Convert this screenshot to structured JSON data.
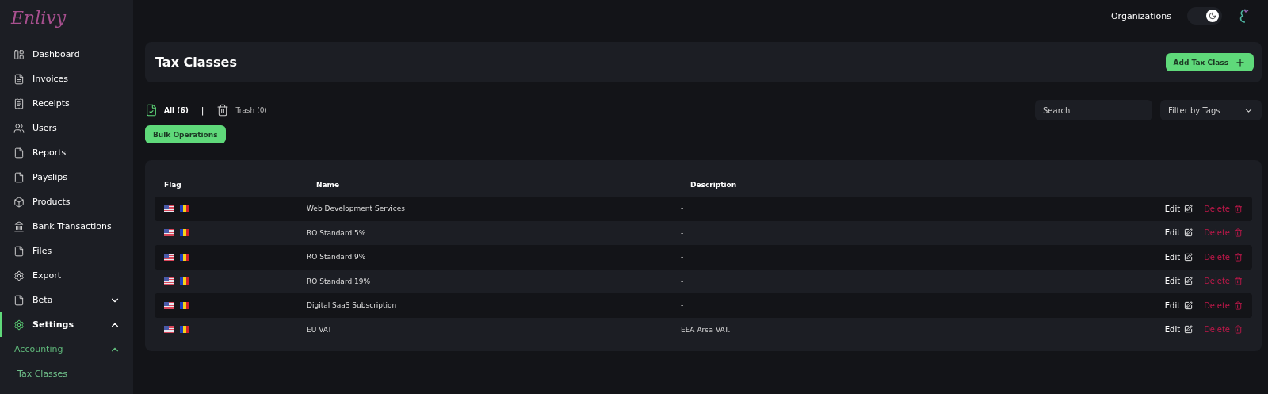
{
  "logo": "Enlivy",
  "sidebar": {
    "items": [
      {
        "label": "Dashboard",
        "selected": false
      },
      {
        "label": "Invoices",
        "selected": false
      },
      {
        "label": "Receipts",
        "selected": false
      },
      {
        "label": "Users",
        "selected": false
      },
      {
        "label": "Reports",
        "selected": false
      },
      {
        "label": "Payslips",
        "selected": false
      },
      {
        "label": "Products",
        "selected": false
      },
      {
        "label": "Bank Transactions",
        "selected": false
      },
      {
        "label": "Files",
        "selected": false
      },
      {
        "label": "Export",
        "selected": false
      },
      {
        "label": "Beta",
        "selected": false,
        "expanded": false
      },
      {
        "label": "Settings",
        "selected": true,
        "expanded": true,
        "children": [
          {
            "label": "Accounting",
            "expanded": true,
            "children": [
              {
                "label": "Tax Classes",
                "selected": true
              }
            ]
          }
        ]
      }
    ]
  },
  "topbar": {
    "organizations": "Organizations",
    "dark_mode": true
  },
  "header": {
    "title": "Tax Classes",
    "add_button": "Add Tax Class"
  },
  "filters": {
    "tabs": [
      {
        "label": "All (6)",
        "selected": true
      },
      {
        "label": "Trash (0)",
        "selected": false
      }
    ],
    "separator": "|",
    "search": {
      "placeholder": "Search"
    },
    "tag_filter": "Filter by Tags",
    "bulk_button": "Bulk Operations"
  },
  "table": {
    "columns": [
      "Flag",
      "Name",
      "Description"
    ],
    "rows": [
      {
        "name": "Web Development Services",
        "description": "-",
        "edit": "Edit",
        "delete": "Delete"
      },
      {
        "name": "RO Standard 5%",
        "description": "-",
        "edit": "Edit",
        "delete": "Delete"
      },
      {
        "name": "RO Standard 9%",
        "description": "-",
        "edit": "Edit",
        "delete": "Delete"
      },
      {
        "name": "RO Standard 19%",
        "description": "-",
        "edit": "Edit",
        "delete": "Delete"
      },
      {
        "name": "Digital SaaS Subscription",
        "description": "-",
        "edit": "Edit",
        "delete": "Delete"
      },
      {
        "name": "EU VAT",
        "description": "EEA Area VAT.",
        "edit": "Edit",
        "delete": "Delete"
      }
    ]
  }
}
